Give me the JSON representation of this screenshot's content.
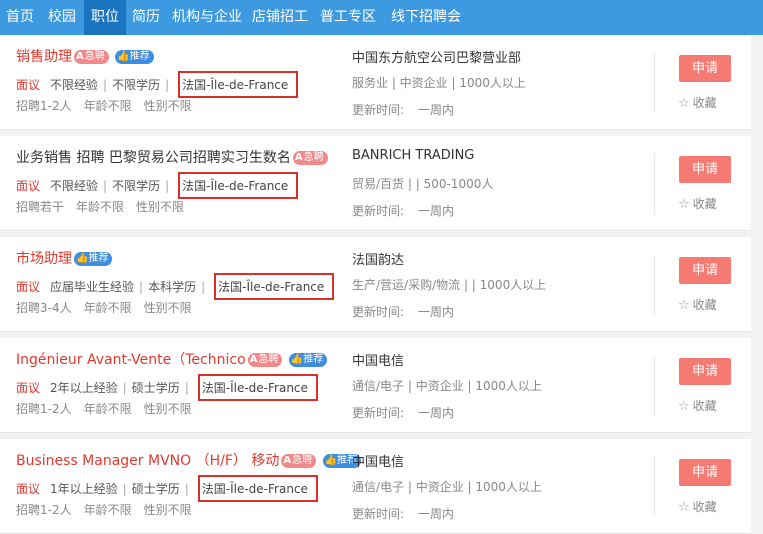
{
  "nav": [
    {
      "label": "首页"
    },
    {
      "label": "校园"
    },
    {
      "label": "职位"
    },
    {
      "label": "简历"
    },
    {
      "label": "机构与企业"
    },
    {
      "label": "店铺招工"
    },
    {
      "label": "普工专区"
    },
    {
      "label": "线下招聘会"
    }
  ],
  "badges": {
    "urgent": "急聘",
    "urgent_icon": "A",
    "recommend": "推荐"
  },
  "jobs": [
    {
      "title": "销售助理",
      "salary": "面议",
      "experience": "不限经验",
      "education": "不限学历",
      "location": "法国-Île-de-France",
      "headcount": "招聘1-2人",
      "age": "年龄不限",
      "gender": "性别不限",
      "company": "中国东方航空公司巴黎营业部",
      "company_info": "服务业 | 中资企业 | 1000人以上",
      "update_label": "更新时间:",
      "update_value": "一周内",
      "apply": "申请",
      "favorite": "收藏"
    },
    {
      "title": "业务销售 招聘 巴黎贸易公司招聘实习生数名",
      "salary": "面议",
      "experience": "不限经验",
      "education": "不限学历",
      "location": "法国-Île-de-France",
      "headcount": "招聘若干",
      "age": "年龄不限",
      "gender": "性别不限",
      "company": "BANRICH TRADING",
      "company_info": "贸易/百货 | | 500-1000人",
      "update_label": "更新时间:",
      "update_value": "一周内",
      "apply": "申请",
      "favorite": "收藏"
    },
    {
      "title": "市场助理",
      "salary": "面议",
      "experience": "应届毕业生经验",
      "education": "本科学历",
      "location": "法国-Île-de-France",
      "headcount": "招聘3-4人",
      "age": "年龄不限",
      "gender": "性别不限",
      "company": "法国韵达",
      "company_info": "生产/营运/采购/物流 | | 1000人以上",
      "update_label": "更新时间:",
      "update_value": "一周内",
      "apply": "申请",
      "favorite": "收藏"
    },
    {
      "title": "Ingénieur Avant-Vente（Technico",
      "salary": "面议",
      "experience": "2年以上经验",
      "education": "硕士学历",
      "location": "法国-Île-de-France",
      "headcount": "招聘1-2人",
      "age": "年龄不限",
      "gender": "性别不限",
      "company": "中国电信",
      "company_info": "通信/电子 | 中资企业 | 1000人以上",
      "update_label": "更新时间:",
      "update_value": "一周内",
      "apply": "申请",
      "favorite": "收藏"
    },
    {
      "title": "Business Manager MVNO （H/F） 移动",
      "salary": "面议",
      "experience": "1年以上经验",
      "education": "硕士学历",
      "location": "法国-Île-de-France",
      "headcount": "招聘1-2人",
      "age": "年龄不限",
      "gender": "性别不限",
      "company": "中国电信",
      "company_info": "通信/电子 | 中资企业 | 1000人以上",
      "update_label": "更新时间:",
      "update_value": "一周内",
      "apply": "申请",
      "favorite": "收藏"
    }
  ],
  "colors": {
    "nav_bg": "#3d9ae0",
    "nav_active": "#1a74bf",
    "accent_red": "#e03a2f",
    "apply_btn": "#f47a72",
    "highlight_box": "#d9302a",
    "recommend_badge": "#3d8de0"
  }
}
